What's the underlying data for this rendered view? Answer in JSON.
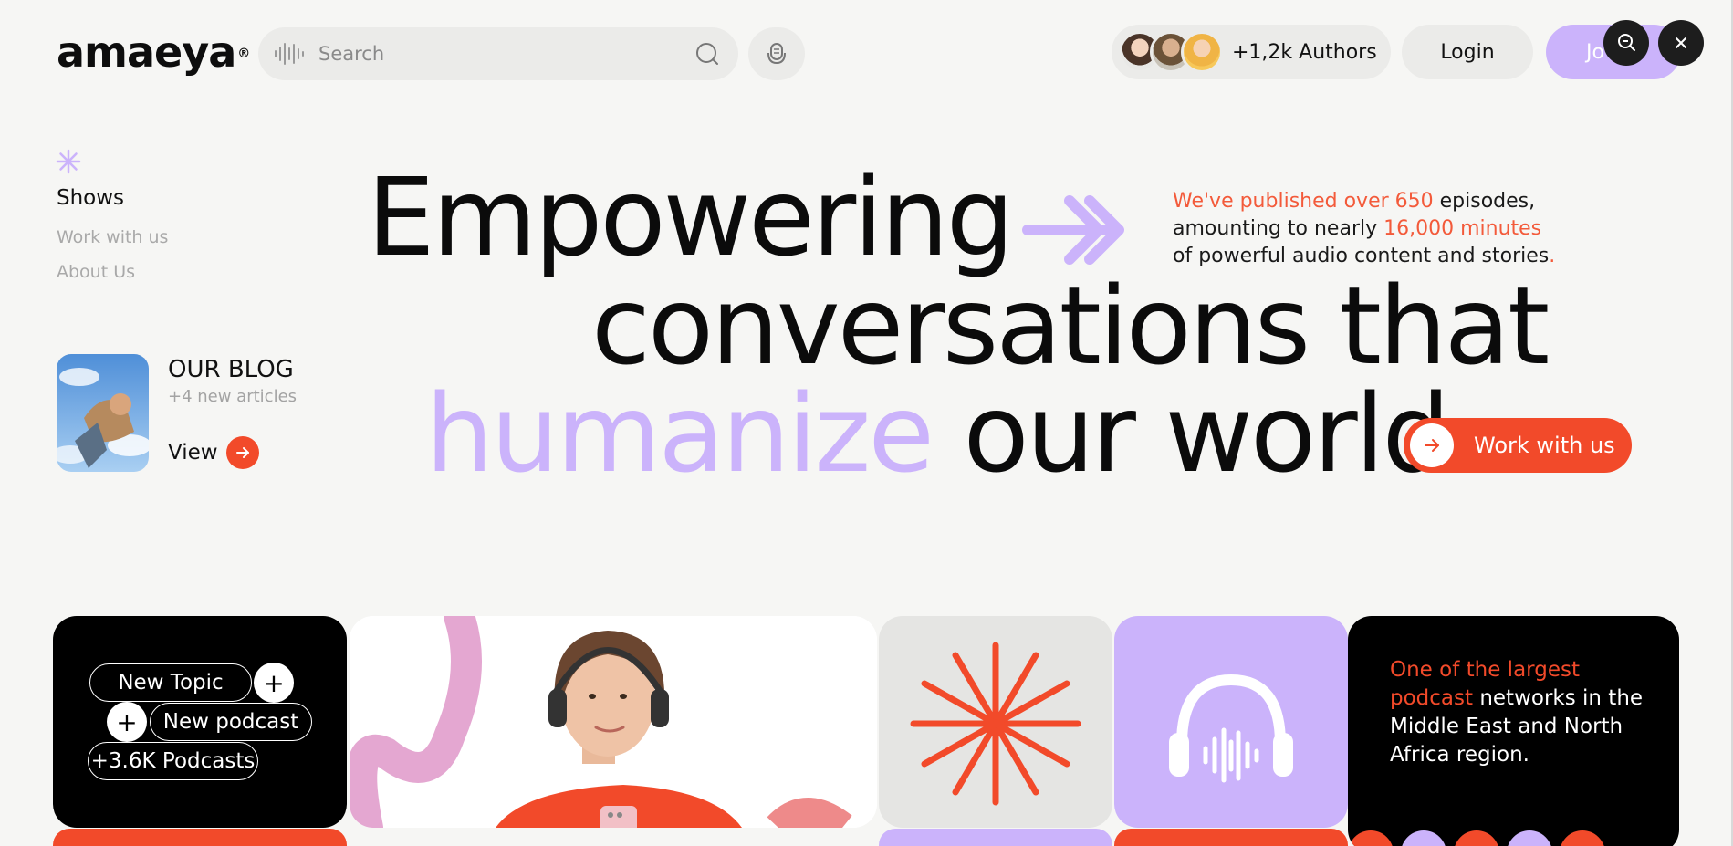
{
  "header": {
    "logo_text": "amaeya",
    "logo_mark": "®",
    "search_placeholder": "Search",
    "authors_label": "+1,2k Authors",
    "login_label": "Login",
    "join_label": "Jo"
  },
  "nav": {
    "items": [
      "Shows",
      "Work with  us",
      "About Us"
    ]
  },
  "blog": {
    "title": "OUR BLOG",
    "subtitle": "+4 new articles",
    "view_label": "View"
  },
  "hero": {
    "line1": "Empowering",
    "line2": "conversations that",
    "line3_highlight": "humanize",
    "line3_rest": "our world",
    "stat_a": "We've published over 650",
    "stat_b": " episodes,",
    "stat_c": "amounting to nearly ",
    "stat_d": "16,000 minutes",
    "stat_e": "of powerful audio content and stories",
    "stat_f": ".",
    "cta_label": "Work with us"
  },
  "cards": {
    "tag_new_topic": "New Topic",
    "tag_new_podcast": "New podcast",
    "tag_podcasts": "+3.6K Podcasts",
    "plus": "+",
    "network_highlight": "One of the largest podcast",
    "network_rest": " networks in the Middle East and North Africa region."
  },
  "colors": {
    "accent_orange": "#f24a2a",
    "accent_purple": "#cbb3fb",
    "background": "#f6f6f4"
  },
  "icons": [
    "sound-wave-icon",
    "search-icon",
    "microphone-icon",
    "zoom-out-icon",
    "close-icon",
    "asterisk-icon",
    "arrow-right-icon",
    "double-chevron-icon",
    "headphones-icon",
    "starburst-icon"
  ]
}
